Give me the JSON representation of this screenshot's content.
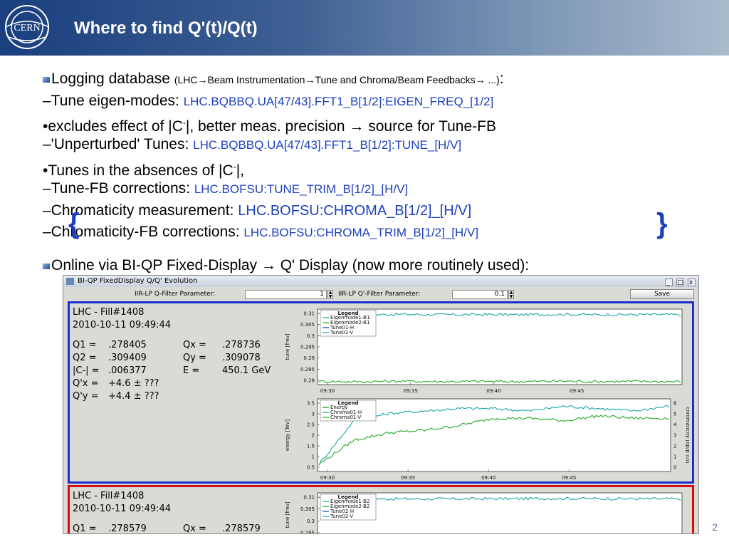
{
  "slide": {
    "title": "Where to find Q'(t)/Q(t)",
    "page_number": "2",
    "bullets": {
      "b1_main": "Logging database ",
      "b1_paren": "(LHC→Beam Instrumentation→Tune and Chroma/Beam Feedbacks→ ...)",
      "b1_colon": ":",
      "b2_main": "–Tune eigen-modes: ",
      "b2_code": "LHC.BQBBQ.UA[47/43].FFT1_B[1/2]:EIGEN_FREQ_[1/2]",
      "b3_pre": "•excludes effect of |C",
      "b3_sup": "-",
      "b3_post": "|, better meas. precision →  source for Tune-FB",
      "b4_main": "–'Unperturbed' Tunes: ",
      "b4_code": "LHC.BQBBQ.UA[47/43].FFT1_B[1/2]:TUNE_[H/V]",
      "b5_pre": "•Tunes in the absences of |C",
      "b5_sup": "-",
      "b5_post": "|,",
      "b6_main": "–Tune-FB corrections: ",
      "b6_code": "LHC.BOFSU:TUNE_TRIM_B[1/2]_[H/V]",
      "b7_main": "–Chromaticity measurement: ",
      "b7_code": "LHC.BOFSU:CHROMA_B[1/2]_[H/V]",
      "b8_main": "–Chromaticity-FB corrections: ",
      "b8_code": "LHC.BOFSU:CHROMA_TRIM_B[1/2]_[H/V]",
      "b9_main": "Online via BI-QP Fixed-Display → Q' Display (now more routinely used):"
    }
  },
  "window": {
    "title": "BI-QP FixedDisplay Q/Q' Evolution",
    "buttons": [
      "_",
      "□",
      "x"
    ],
    "q_filter_label": "IIR-LP Q-Filter Parameter:",
    "q_filter_value": "1",
    "qp_filter_label": "IIR-LP Q'-Filter Parameter:",
    "qp_filter_value": "0.1",
    "save_label": "Save"
  },
  "beam1": {
    "fill": "LHC - Fill#1408",
    "time": "2010-10-11 09:49:44",
    "q1_label": "Q1 =",
    "q1": ".278405",
    "qx_label": "Qx =",
    "qx": ".278736",
    "q2_label": "Q2 =",
    "q2": ".309409",
    "qy_label": "Qy =",
    "qy": ".309078",
    "c_label": "|C-| =",
    "c": ".006377",
    "e_label": "E =",
    "e": "450.1 GeV",
    "qpx_label": "Q'x =",
    "qpx": "+4.6 ± ???",
    "qpy_label": "Q'y =",
    "qpy": "+4.4 ± ???"
  },
  "beam2": {
    "fill": "LHC - Fill#1408",
    "time": "2010-10-11 09:49:44",
    "q1_label": "Q1 =",
    "q1": ".278579",
    "qx_label": "Qx =",
    "qx": ".278579"
  },
  "colors": {
    "beam1_border": "#1a2fd0",
    "beam2_border": "#d01010",
    "tune_a": "#19a6a6",
    "tune_b": "#22aa22",
    "energy": "#1d8f1d",
    "chroma_a": "#19a6a6",
    "chroma_b": "#22aa22"
  },
  "chart_data": [
    {
      "type": "line",
      "ylabel": "tune [frev]",
      "x_ticks": [
        "09:30",
        "09:35",
        "09:40",
        "09:45"
      ],
      "y_ticks": [
        "0.31",
        "0.305",
        "0.3",
        "0.295",
        "0.29",
        "0.285",
        "0.28"
      ],
      "ylim": [
        0.277,
        0.312
      ],
      "legend_title": "Legend",
      "legend": "top-left",
      "series": [
        {
          "name": "Eigenmode1-B1",
          "values": [
            0.3095,
            0.3093,
            0.3096,
            0.3094,
            0.3095,
            0.3094,
            0.3096,
            0.3094,
            0.3095,
            0.3094
          ]
        },
        {
          "name": "Eigenmode2-B1",
          "values": [
            0.2785,
            0.2783,
            0.2786,
            0.2784,
            0.2785,
            0.2784,
            0.2786,
            0.2784,
            0.2785,
            0.2784
          ]
        },
        {
          "name": "Tune01-H",
          "values": []
        },
        {
          "name": "Tune01-V",
          "values": []
        }
      ]
    },
    {
      "type": "line",
      "ylabel": "energy [TeV]",
      "y2label": "chromaticity [dp/p (0)]",
      "x_ticks": [
        "09:30",
        "09:35",
        "09:40",
        "09:45"
      ],
      "y_ticks": [
        "3.5",
        "3",
        "2.5",
        "2",
        "1.5",
        "1",
        "0.5"
      ],
      "y2_ticks": [
        "6",
        "5",
        "4",
        "3",
        "2",
        "1",
        "0"
      ],
      "ylim": [
        0.5,
        3.5
      ],
      "legend_title": "Legend",
      "legend": "top-left",
      "series": [
        {
          "name": "Energy",
          "values": []
        },
        {
          "name": "Chroma01-H",
          "values": [
            0.8,
            2.6,
            2.9,
            3.0,
            3.1,
            3.1,
            3.0,
            3.2,
            3.1,
            3.0,
            3.2
          ]
        },
        {
          "name": "Chroma01-V",
          "values": [
            0.8,
            1.8,
            2.1,
            2.2,
            2.4,
            2.7,
            2.7,
            2.6,
            2.8,
            2.7,
            2.7
          ]
        }
      ]
    },
    {
      "type": "line",
      "ylabel": "tune [frev]",
      "y_ticks": [
        "0.31",
        "0.305",
        "0.3",
        "0.295"
      ],
      "legend_title": "Legend",
      "legend": "top-left",
      "series": [
        {
          "name": "Eigenmode1-B2",
          "values": [
            0.3095,
            0.3094,
            0.3096,
            0.3094
          ]
        },
        {
          "name": "Eigenmode2-B2",
          "values": []
        },
        {
          "name": "Tune02-H",
          "values": []
        },
        {
          "name": "Tune02-V",
          "values": []
        }
      ]
    }
  ]
}
